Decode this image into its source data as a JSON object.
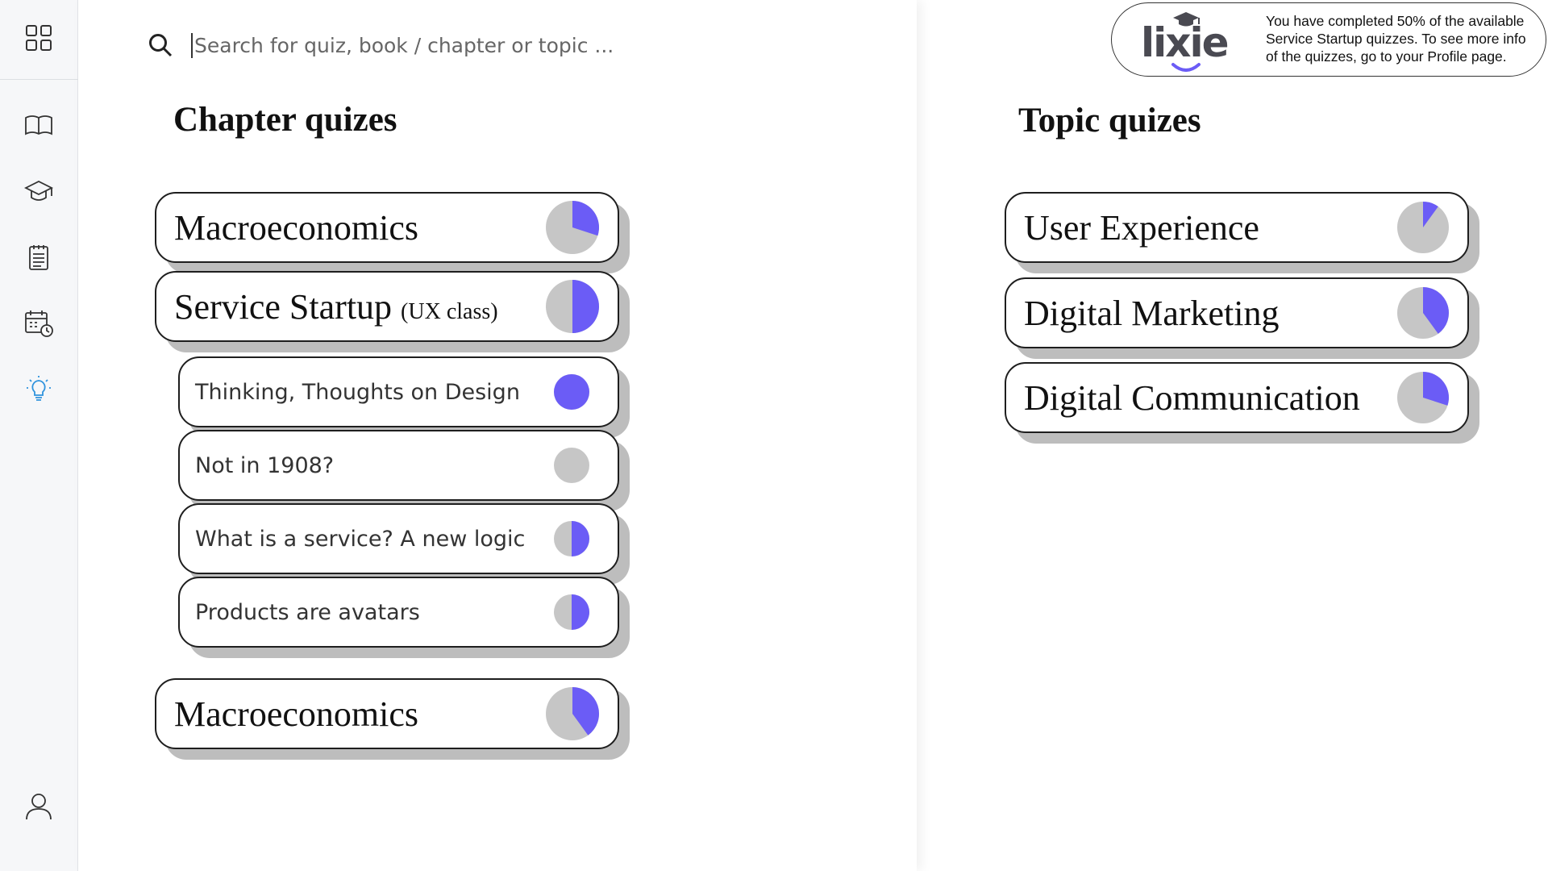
{
  "sidebar": {
    "icons": [
      "apps-grid-icon",
      "book-icon",
      "graduation-cap-icon",
      "notepad-icon",
      "calendar-clock-icon",
      "lightbulb-icon",
      "user-icon"
    ],
    "active": "lightbulb-icon",
    "active_color": "#2f93dd"
  },
  "search": {
    "placeholder": "Search for quiz, book / chapter or topic ..."
  },
  "chapter_section": {
    "title": "Chapter quizes",
    "items": [
      {
        "label": "Macroeconomics",
        "progress": 0.3
      },
      {
        "label": "Service Startup",
        "label_suffix": "(UX class)",
        "progress": 0.5,
        "subitems": [
          {
            "label": "Thinking, Thoughts on Design",
            "progress": 1.0
          },
          {
            "label": "Not in 1908?",
            "progress": 0.0
          },
          {
            "label": "What is a service? A new logic",
            "progress": 0.5
          },
          {
            "label": "Products are avatars",
            "progress": 0.5
          }
        ]
      },
      {
        "label": "Macroeconomics",
        "progress": 0.4
      }
    ]
  },
  "topic_section": {
    "title": "Topic quizes",
    "items": [
      {
        "label": "User Experience",
        "progress": 0.1
      },
      {
        "label": "Digital Marketing",
        "progress": 0.4
      },
      {
        "label": "Digital Communication",
        "progress": 0.3
      }
    ]
  },
  "notification": {
    "logo_text": "lixie",
    "message": "You have completed 50% of the available Service Startup quizzes. To see more info of the quizzes, go to your Profile page."
  },
  "colors": {
    "progress_fill": "#6b5cf6",
    "progress_track": "#c6c6c6",
    "card_shadow": "#bdbdbd"
  }
}
